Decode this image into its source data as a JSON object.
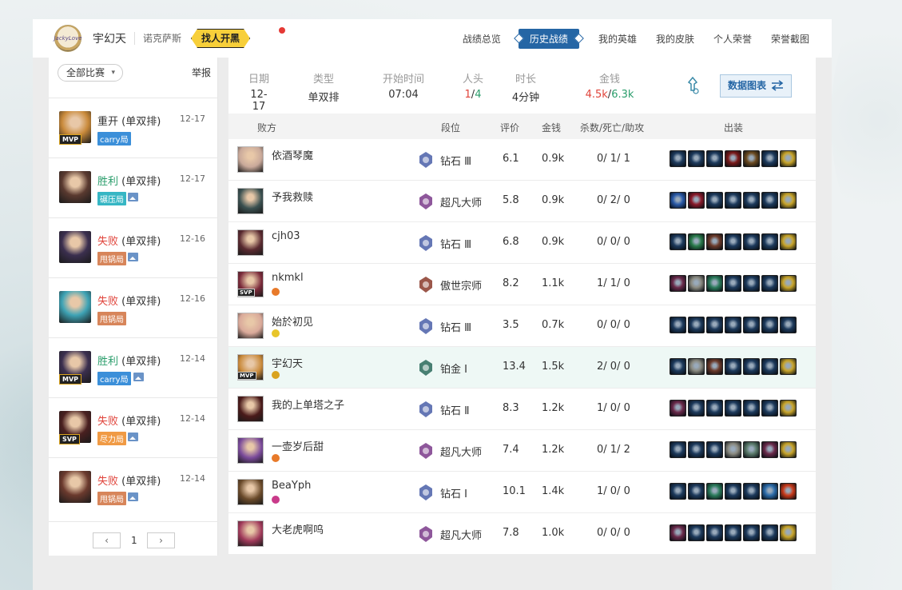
{
  "header": {
    "player_name": "宇幻天",
    "region": "诺克萨斯",
    "find_button": "找人开黑",
    "logo_text": "JackyLove"
  },
  "nav": [
    {
      "label": "战绩总览",
      "active": false
    },
    {
      "label": "历史战绩",
      "active": true
    },
    {
      "label": "我的英雄",
      "active": false
    },
    {
      "label": "我的皮肤",
      "active": false
    },
    {
      "label": "个人荣誉",
      "active": false
    },
    {
      "label": "荣誉截图",
      "active": false
    }
  ],
  "sidebar": {
    "filter_label": "全部比赛",
    "report_label": "举报",
    "matches": [
      {
        "result": "重开",
        "result_type": "neutral",
        "mode": "(单双排)",
        "date": "12-17",
        "tag": "carry局",
        "tag_type": "carry",
        "badge": "MVP",
        "has_pic": false,
        "portrait_color": "#c98a3b"
      },
      {
        "result": "胜利",
        "result_type": "win",
        "mode": "(单双排)",
        "date": "12-17",
        "tag": "碾压局",
        "tag_type": "crush",
        "badge": "",
        "has_pic": true,
        "portrait_color": "#5a3a30"
      },
      {
        "result": "失败",
        "result_type": "lose",
        "mode": "(单双排)",
        "date": "12-16",
        "tag": "甩锅局",
        "tag_type": "mess",
        "badge": "",
        "has_pic": true,
        "portrait_color": "#3b2f4f"
      },
      {
        "result": "失败",
        "result_type": "lose",
        "mode": "(单双排)",
        "date": "12-16",
        "tag": "甩锅局",
        "tag_type": "mess",
        "badge": "",
        "has_pic": false,
        "portrait_color": "#3ea3b5"
      },
      {
        "result": "胜利",
        "result_type": "win",
        "mode": "(单双排)",
        "date": "12-14",
        "tag": "carry局",
        "tag_type": "carry",
        "badge": "MVP",
        "has_pic": true,
        "portrait_color": "#3b2f4f"
      },
      {
        "result": "失败",
        "result_type": "lose",
        "mode": "(单双排)",
        "date": "12-14",
        "tag": "尽力局",
        "tag_type": "effort",
        "badge": "SVP",
        "has_pic": true,
        "portrait_color": "#4a2020"
      },
      {
        "result": "失败",
        "result_type": "lose",
        "mode": "(单双排)",
        "date": "12-14",
        "tag": "甩锅局",
        "tag_type": "mess",
        "badge": "",
        "has_pic": true,
        "portrait_color": "#6b3a2e"
      }
    ],
    "pager": {
      "prev": "‹",
      "page": "1",
      "next": "›"
    }
  },
  "summary": {
    "date_label": "日期",
    "date": "12-17",
    "type_label": "类型",
    "type": "单双排",
    "start_label": "开始时间",
    "start": "07:04",
    "kills_label": "人头",
    "kills_a": "1",
    "kills_b": "4",
    "duration_label": "时长",
    "duration": "4分钟",
    "gold_label": "金钱",
    "gold_a": "4.5k",
    "gold_b": "6.3k",
    "chart_button": "数据图表"
  },
  "table": {
    "headers": {
      "team": "败方",
      "rank": "段位",
      "score": "评价",
      "gold": "金钱",
      "kda": "杀数/死亡/助攻",
      "items": "出装"
    },
    "rows": [
      {
        "name": "依酒琴魔",
        "rank": "钻石 Ⅲ",
        "rank_color": "#4a5fa8",
        "score": "6.1",
        "gold": "0.9k",
        "kda": "0/ 1/ 1",
        "me": false,
        "svp": "",
        "mini": "",
        "portrait": "#c9a99a",
        "items": [
          "#1d3a5c",
          "#1d3a5c",
          "#1d3a5c",
          "#7a1a1a",
          "#6b4a20",
          "#1d3a5c",
          "#c9a52a"
        ]
      },
      {
        "name": "予我救赎",
        "rank": "超凡大师",
        "rank_color": "#7a3a8a",
        "score": "5.8",
        "gold": "0.9k",
        "kda": "0/ 2/ 0",
        "me": false,
        "svp": "",
        "mini": "",
        "portrait": "#3a5050",
        "items": [
          "#2a5aa8",
          "#8a1a2a",
          "#1d3a5c",
          "#1d3a5c",
          "#1d3a5c",
          "#1d3a5c",
          "#c9a52a"
        ]
      },
      {
        "name": "cjh03",
        "rank": "钻石 Ⅲ",
        "rank_color": "#4a5fa8",
        "score": "6.8",
        "gold": "0.9k",
        "kda": "0/ 0/ 0",
        "me": false,
        "svp": "",
        "mini": "",
        "portrait": "#5a2a30",
        "items": [
          "#1d3a5c",
          "#2a7a4a",
          "#6b3a2a",
          "#1d3a5c",
          "#1d3a5c",
          "#1d3a5c",
          "#c9a52a"
        ]
      },
      {
        "name": "nkmkl",
        "rank": "傲世宗师",
        "rank_color": "#8a3a2a",
        "score": "8.2",
        "gold": "1.1k",
        "kda": "1/ 1/ 0",
        "me": false,
        "svp": "SVP",
        "mini": "#e87a2a",
        "portrait": "#7a2a3a",
        "items": [
          "#6a2a4a",
          "#8a8a80",
          "#2a7a5a",
          "#1d3a5c",
          "#1d3a5c",
          "#1d3a5c",
          "#c9a52a"
        ]
      },
      {
        "name": "始於初见",
        "rank": "钻石 Ⅲ",
        "rank_color": "#4a5fa8",
        "score": "3.5",
        "gold": "0.7k",
        "kda": "0/ 0/ 0",
        "me": false,
        "svp": "",
        "mini": "#e8c52a",
        "portrait": "#d9a99a",
        "items": [
          "#1d3a5c",
          "#1d3a5c",
          "#1d3a5c",
          "#1d3a5c",
          "#1d3a5c",
          "#1d3a5c",
          "#1d3a5c"
        ]
      },
      {
        "name": "宇幻天",
        "rank": "铂金 Ⅰ",
        "rank_color": "#2a6a5a",
        "score": "13.4",
        "gold": "1.5k",
        "kda": "2/ 0/ 0",
        "me": true,
        "svp": "MVP",
        "mini": "#d9a31f",
        "portrait": "#c98a3b",
        "items": [
          "#1d3a5c",
          "#8a8a80",
          "#6b3a2a",
          "#1d3a5c",
          "#1d3a5c",
          "#1d3a5c",
          "#c9a52a"
        ]
      },
      {
        "name": "我的上单塔之子",
        "rank": "钻石 Ⅱ",
        "rank_color": "#4a5fa8",
        "score": "8.3",
        "gold": "1.2k",
        "kda": "1/ 0/ 0",
        "me": false,
        "svp": "",
        "mini": "",
        "portrait": "#4a1a1a",
        "items": [
          "#6a2a4a",
          "#1d3a5c",
          "#1d3a5c",
          "#1d3a5c",
          "#1d3a5c",
          "#1d3a5c",
          "#c9a52a"
        ]
      },
      {
        "name": "一壶岁后甜",
        "rank": "超凡大师",
        "rank_color": "#7a3a8a",
        "score": "7.4",
        "gold": "1.2k",
        "kda": "0/ 1/ 2",
        "me": false,
        "svp": "",
        "mini": "#e87a2a",
        "portrait": "#7a4a9a",
        "items": [
          "#1d3a5c",
          "#1d3a5c",
          "#1d3a5c",
          "#8a8a80",
          "#5a7a6a",
          "#6a2a4a",
          "#c9a52a"
        ]
      },
      {
        "name": "BeaYph",
        "rank": "钻石 Ⅰ",
        "rank_color": "#4a5fa8",
        "score": "10.1",
        "gold": "1.4k",
        "kda": "1/ 0/ 0",
        "me": false,
        "svp": "",
        "mini": "#c93a8a",
        "portrait": "#6a4a2a",
        "items": [
          "#1d3a5c",
          "#1d3a5c",
          "#2a7a5a",
          "#1d3a5c",
          "#1d3a5c",
          "#2a6aa8",
          "#c93a1a"
        ]
      },
      {
        "name": "大老虎啊呜",
        "rank": "超凡大师",
        "rank_color": "#7a3a8a",
        "score": "7.8",
        "gold": "1.0k",
        "kda": "0/ 0/ 0",
        "me": false,
        "svp": "",
        "mini": "",
        "portrait": "#a03a5a",
        "items": [
          "#6a2a4a",
          "#1d3a5c",
          "#1d3a5c",
          "#1d3a5c",
          "#1d3a5c",
          "#1d3a5c",
          "#c9a52a"
        ]
      }
    ]
  }
}
